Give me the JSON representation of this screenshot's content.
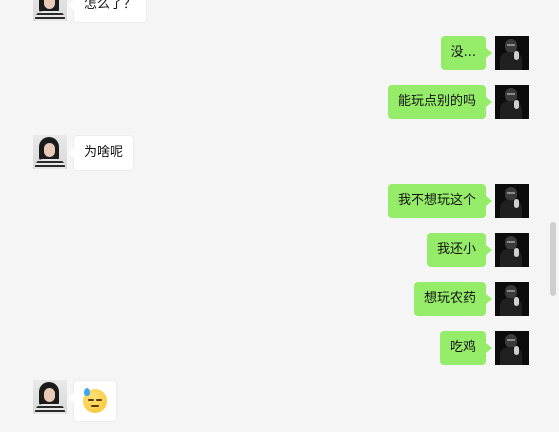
{
  "chat": {
    "messages": [
      {
        "side": "left",
        "text": "怎么了？",
        "avatar": "girl-avatar"
      },
      {
        "side": "right",
        "text": "没...",
        "avatar": "man-avatar"
      },
      {
        "side": "right",
        "text": "能玩点别的吗",
        "avatar": "man-avatar"
      },
      {
        "side": "left",
        "text": "为啥呢",
        "avatar": "girl-avatar"
      },
      {
        "side": "right",
        "text": "我不想玩这个",
        "avatar": "man-avatar"
      },
      {
        "side": "right",
        "text": "我还小",
        "avatar": "man-avatar"
      },
      {
        "side": "right",
        "text": "想玩农药",
        "avatar": "man-avatar"
      },
      {
        "side": "right",
        "text": "吃鸡",
        "avatar": "man-avatar"
      },
      {
        "side": "left",
        "emoji": "sweat-downcast-emoji",
        "avatar": "girl-avatar"
      }
    ]
  },
  "colors": {
    "background": "#f5f5f5",
    "sent_bubble": "#95ec69",
    "received_bubble": "#ffffff"
  }
}
